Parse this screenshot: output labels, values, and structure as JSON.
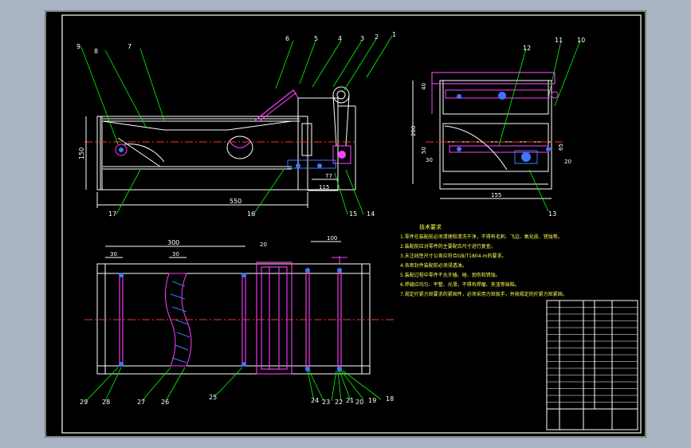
{
  "colors": {
    "background": "#a9b4c2",
    "sheet": "#000000",
    "line": "#ffffff",
    "leader": "#00ff00",
    "centerline": "#ff3030",
    "part": "#ff40ff",
    "hidden": "#3c78ff",
    "note": "#ffff55"
  },
  "dimensions": {
    "front": {
      "width": "550",
      "height": "150",
      "d77": "77",
      "d115": "115"
    },
    "side": {
      "width": "155",
      "height": "200",
      "d40": "40",
      "d50": "50",
      "d30": "30",
      "d65": "65",
      "d20": "20"
    },
    "top": {
      "d300": "300",
      "d30a": "30",
      "d30b": "30",
      "d20": "20",
      "d100": "100"
    }
  },
  "balloons": {
    "front": [
      "1",
      "2",
      "3",
      "4",
      "5",
      "6",
      "7",
      "8",
      "9",
      "14",
      "15",
      "16",
      "17"
    ],
    "side": [
      "10",
      "11",
      "12",
      "13"
    ],
    "top": [
      "18",
      "19",
      "20",
      "21",
      "22",
      "23",
      "24",
      "25",
      "26",
      "27",
      "28",
      "29"
    ]
  },
  "notes": {
    "title": "技术要求",
    "lines": [
      "1.零件在装配前必须清理和清洗干净，不得有毛刺、飞边、氧化皮、锈蚀等。",
      "2.装配前应对零件的主要配合尺寸进行复查。",
      "3.未注线性尺寸公差应符合GB/T1804-m的要求。",
      "4.各密封件装配前必须浸透油。",
      "5.装配过程中零件不允许磕、碰、划伤和锈蚀。",
      "6.焊缝应均匀、平整、光滑，不得有焊瘤、夹渣等缺陷。",
      "7.规定拧紧力矩要求的紧固件，必须采用力矩扳手，并按规定的拧紧力矩紧固。"
    ]
  }
}
